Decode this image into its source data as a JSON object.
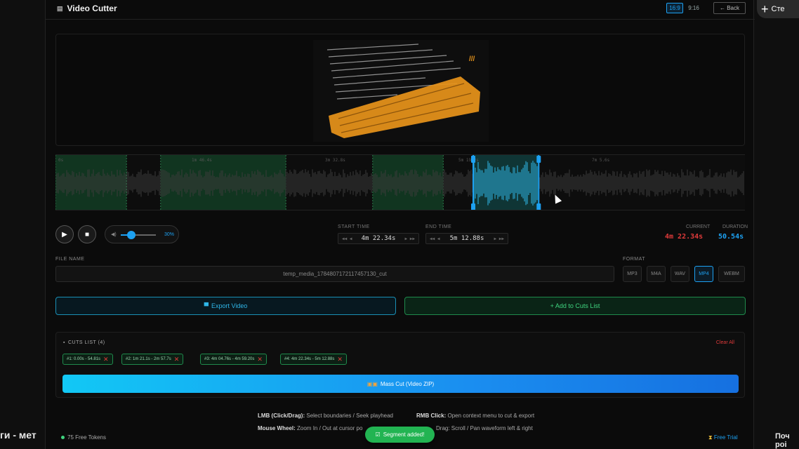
{
  "background": {
    "left_text": "ги - мет",
    "right_button_label": "Сте",
    "right_text_line1": "Поч",
    "right_text_line2": "poi"
  },
  "header": {
    "title": "Video Cutter",
    "ratio_options": [
      "16:9",
      "9:16"
    ],
    "active_ratio": "16:9",
    "back_label": "← Back"
  },
  "timeline": {
    "tick_labels": [
      "0s",
      "1m 46.4s",
      "3m 32.8s",
      "5m 19.2s",
      "7m 5.6s"
    ],
    "segments": [
      {
        "start": 0.0,
        "end": 54.81
      },
      {
        "start": 81.13,
        "end": 177.77
      },
      {
        "start": 244.76,
        "end": 299.2
      },
      {
        "start": 322.34,
        "end": 372.88
      }
    ],
    "total_seconds": 532,
    "selection": {
      "start": 322.34,
      "end": 372.88
    }
  },
  "controls": {
    "volume_percent": "30%",
    "volume_level": 0.3,
    "start_label": "START TIME",
    "start_value": "4m 22.34s",
    "end_label": "END TIME",
    "end_value": "5m 12.88s",
    "current_label": "CURRENT",
    "current_value": "4m 22.34s",
    "duration_label": "DURATION",
    "duration_value": "50.54s"
  },
  "file": {
    "label": "FILE NAME",
    "value": "temp_media_1784807172117457130_cut"
  },
  "format": {
    "label": "FORMAT",
    "options": [
      "MP3",
      "M4A",
      "WAV",
      "MP4",
      "WEBM"
    ],
    "active": "MP4"
  },
  "actions": {
    "export_label": "Export Video",
    "add_cut_label": "+ Add to Cuts List"
  },
  "cuts": {
    "title": "CUTS LIST (4)",
    "clear_label": "Clear All",
    "items": [
      "#1: 0.00s - 54.81s",
      "#2: 1m 21.1s - 2m 57.7s",
      "#3: 4m 04.76s - 4m 59.20s",
      "#4: 4m 22.34s - 5m 12.88s"
    ],
    "mass_cut_label": "Mass Cut (Video ZIP)"
  },
  "footer": {
    "help_lmb_key": "LMB (Click/Drag):",
    "help_lmb_text": "Select boundaries / Seek playhead",
    "help_rmb_key": "RMB Click:",
    "help_rmb_text": "Open context menu to cut & export",
    "help_wheel_key": "Mouse Wheel:",
    "help_wheel_text": "Zoom In / Out at cursor po",
    "help_drag_text": "Drag: Scroll / Pan waveform left & right",
    "tokens": "75 Free Tokens",
    "trial": "Free Trial",
    "toast": "Segment added!"
  }
}
